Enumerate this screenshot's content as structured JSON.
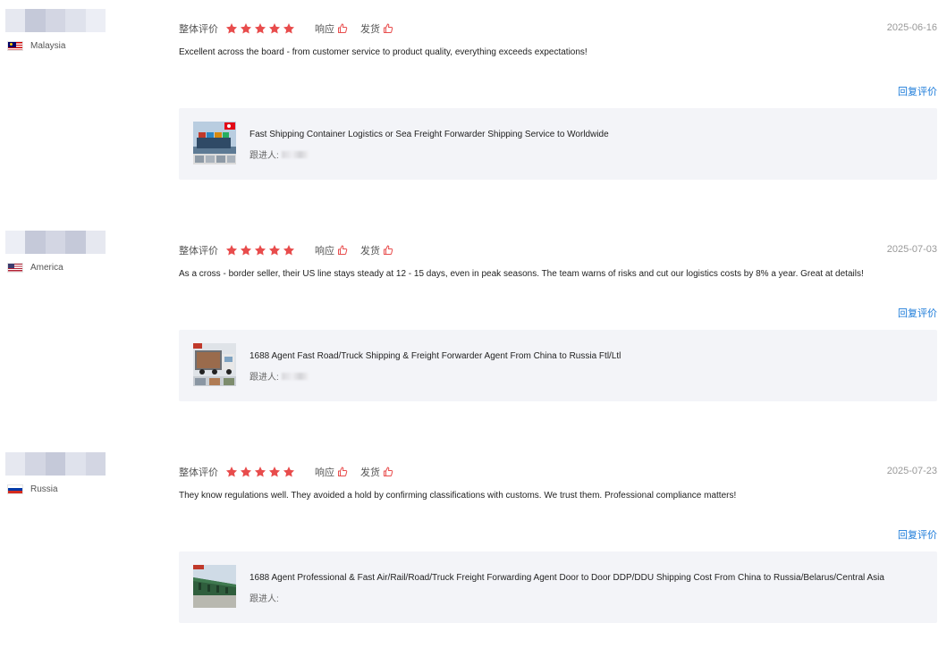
{
  "labels": {
    "overall": "整体评价",
    "response": "响应",
    "shipping": "发货",
    "reply": "回复评价",
    "followup": "跟进人:"
  },
  "colors": {
    "star": "#e84c4c",
    "link": "#1a7ad9",
    "card_bg": "#f3f4f8"
  },
  "reviews": [
    {
      "country": "Malaysia",
      "flag_icon": "malaysia-flag-icon",
      "rating": 5,
      "date": "2025-06-16",
      "text": "Excellent across the board - from customer service to product quality, everything exceeds expectations!",
      "product": {
        "title": "Fast Shipping Container Logistics or Sea Freight Forwarder Shipping Service to Worldwide",
        "thumb_icon": "container-ship-image"
      }
    },
    {
      "country": "America",
      "flag_icon": "usa-flag-icon",
      "rating": 5,
      "date": "2025-07-03",
      "text": "As a cross - border seller, their US line stays steady at 12 - 15 days, even in peak seasons. The team warns of risks and cut our logistics costs by 8% a year. Great at details!",
      "product": {
        "title": "1688 Agent Fast Road/Truck Shipping & Freight Forwarder Agent From China to Russia Ftl/Ltl",
        "thumb_icon": "truck-image"
      }
    },
    {
      "country": "Russia",
      "flag_icon": "russia-flag-icon",
      "rating": 5,
      "date": "2025-07-23",
      "text": "They know regulations well. They avoided a hold by confirming classifications with customs. We trust them. Professional compliance matters!",
      "product": {
        "title": "1688 Agent Professional & Fast Air/Rail/Road/Truck Freight Forwarding Agent Door to Door DDP/DDU Shipping Cost From China to Russia/Belarus/Central Asia",
        "thumb_icon": "train-image"
      }
    }
  ]
}
